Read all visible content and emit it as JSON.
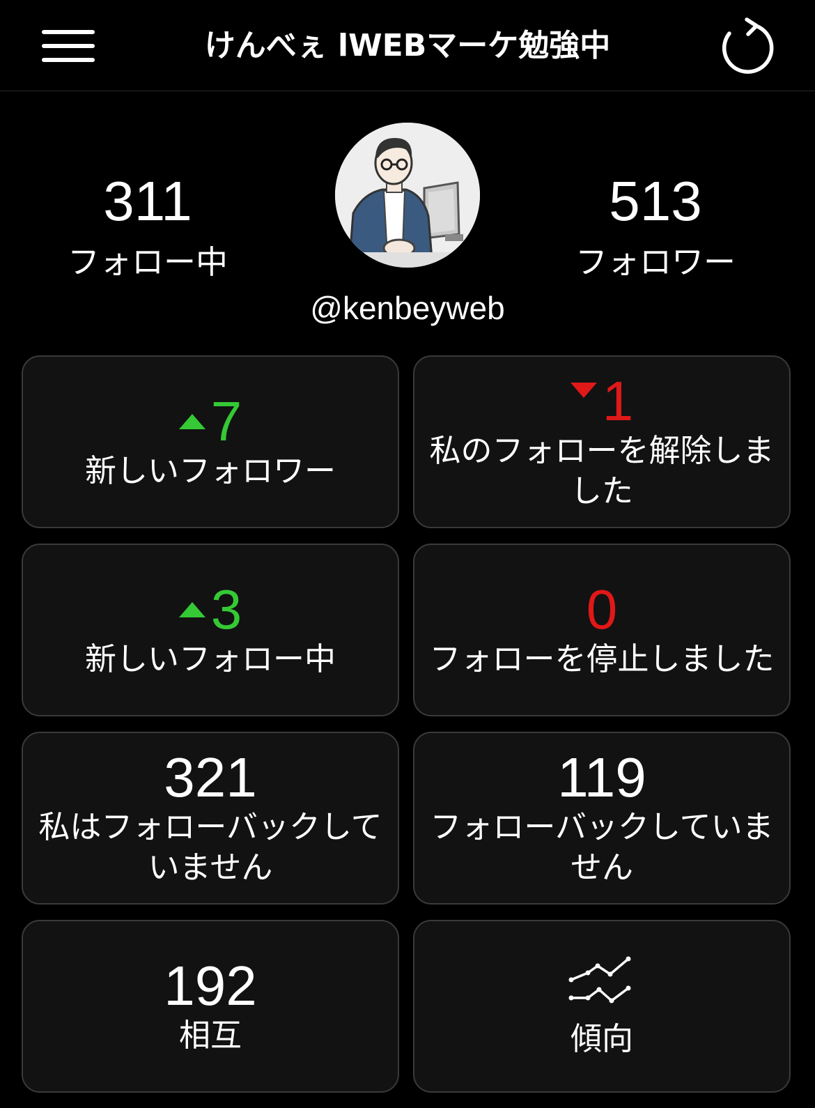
{
  "header": {
    "title": "けんべぇ lWEBマーケ勉強中",
    "menu_icon": "hamburger-menu-icon",
    "refresh_icon": "refresh-icon"
  },
  "profile": {
    "following_count": "311",
    "following_label": "フォロー中",
    "followers_count": "513",
    "followers_label": "フォロワー",
    "handle": "@kenbeyweb"
  },
  "cards": [
    {
      "value": "7",
      "trend": "up",
      "label": "新しいフォロワー"
    },
    {
      "value": "1",
      "trend": "down",
      "label": "私のフォローを解除しました"
    },
    {
      "value": "3",
      "trend": "up",
      "label": "新しいフォロー中"
    },
    {
      "value": "0",
      "trend": "none-red",
      "label": "フォローを停止しました"
    },
    {
      "value": "321",
      "trend": "none",
      "label": "私はフォローバックしていません"
    },
    {
      "value": "119",
      "trend": "none",
      "label": "フォローバックしていません"
    },
    {
      "value": "192",
      "trend": "none",
      "label": "相互"
    },
    {
      "icon": "trend-chart-icon",
      "label": "傾向"
    }
  ],
  "colors": {
    "background": "#000000",
    "card_background": "#121212",
    "card_border": "#3a3a3a",
    "increase_green": "#35c935",
    "decrease_red": "#e01818",
    "text": "#ffffff"
  }
}
